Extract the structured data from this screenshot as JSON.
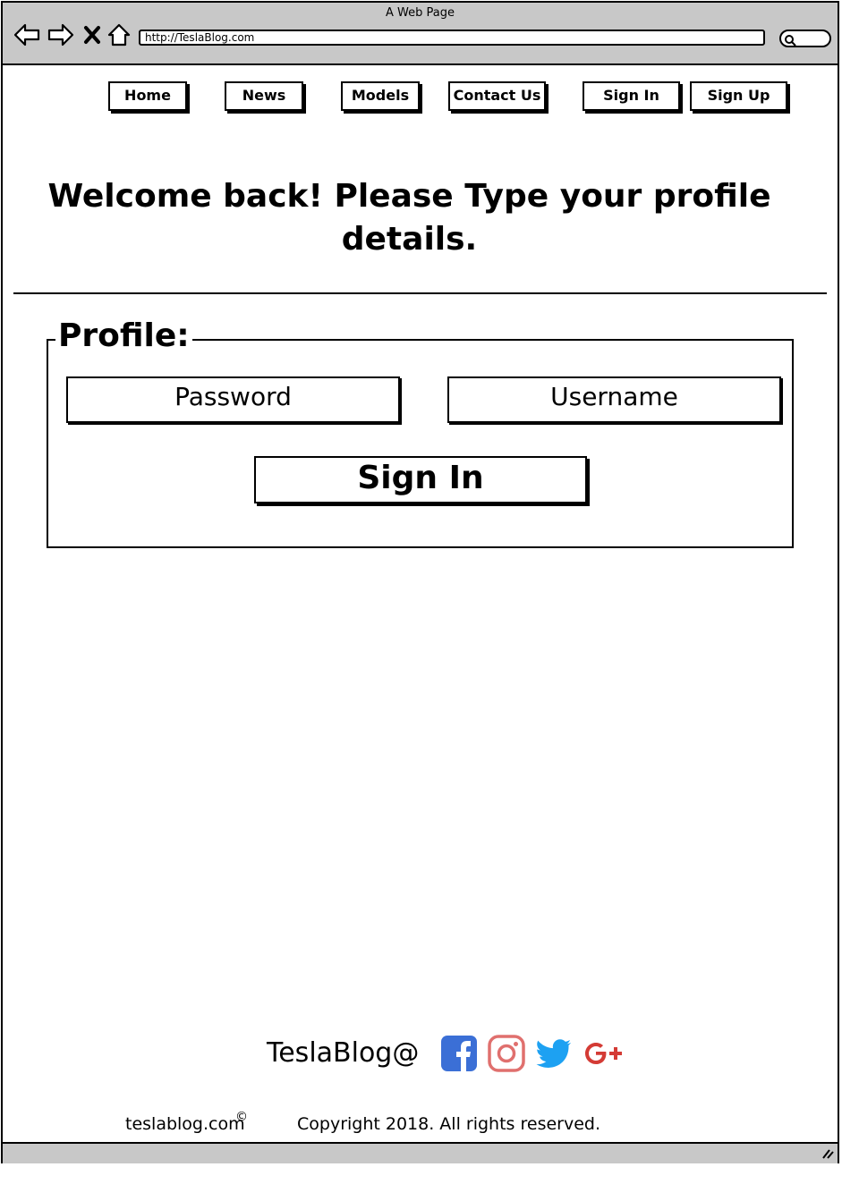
{
  "window": {
    "title": "A Web Page"
  },
  "browser": {
    "url": "http://TeslaBlog.com",
    "icons": [
      "back-arrow-icon",
      "forward-arrow-icon",
      "close-icon",
      "home-icon",
      "search-icon"
    ]
  },
  "nav": {
    "items": [
      {
        "label": "Home"
      },
      {
        "label": "News"
      },
      {
        "label": "Models"
      },
      {
        "label": "Contact Us"
      },
      {
        "label": "Sign In"
      },
      {
        "label": "Sign Up"
      }
    ]
  },
  "main": {
    "headline": "Welcome back! Please Type your profile details.",
    "profile": {
      "legend": "Profile:",
      "password_placeholder": "Password",
      "username_placeholder": "Username",
      "signin_label": "Sign In"
    }
  },
  "footer": {
    "brand": "TeslaBlog@",
    "social": [
      "facebook-icon",
      "instagram-icon",
      "twitter-icon",
      "google-plus-icon"
    ],
    "site": "teslablog.com",
    "copyright_symbol": "©",
    "rights": "Copyright 2018. All rights reserved."
  },
  "colors": {
    "chrome_gray": "#c8c8c8",
    "facebook": "#3b6fd6",
    "instagram": "#e0706e",
    "twitter": "#1da1f2",
    "google_plus": "#d43b35"
  }
}
